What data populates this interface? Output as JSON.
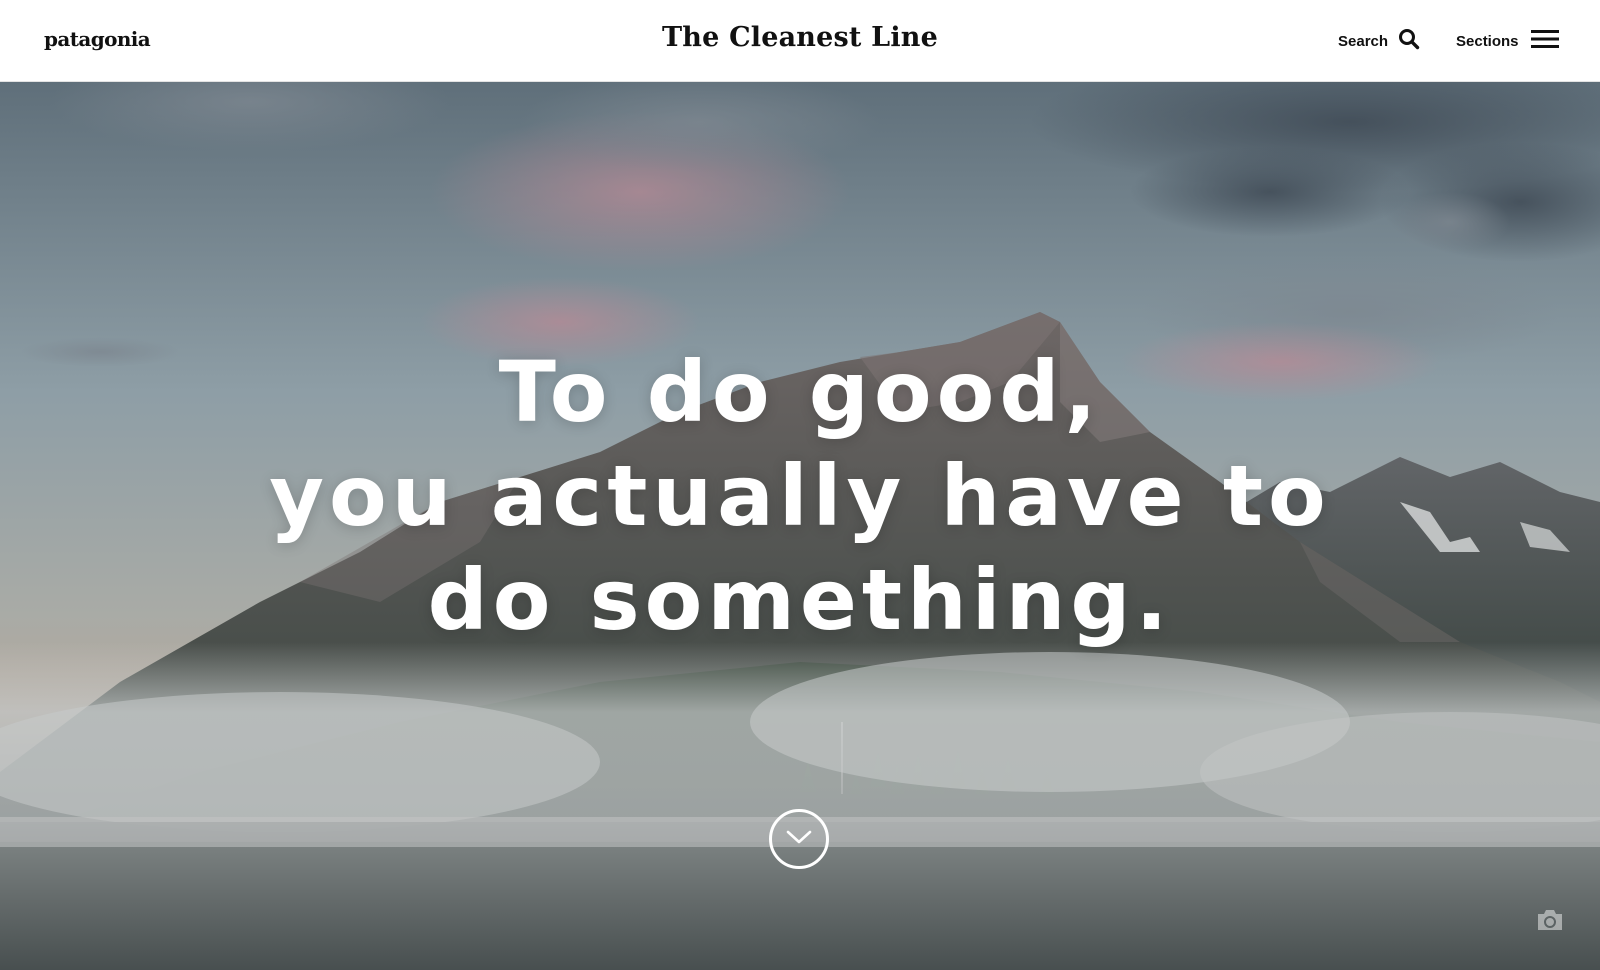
{
  "header": {
    "logo_text": "patagonia",
    "site_title": "The Cleanest Line",
    "search_label": "Search",
    "sections_label": "Sections",
    "icons": {
      "search": "search-icon",
      "menu": "hamburger-menu-icon"
    }
  },
  "hero": {
    "headline_lines": [
      "To do good,",
      "you actually have to",
      "do something."
    ],
    "icons": {
      "scroll": "chevron-down-icon",
      "photo_info": "camera-icon"
    }
  },
  "colors": {
    "header_bg": "#ffffff",
    "text_dark": "#111111",
    "hero_text": "#ffffff"
  }
}
